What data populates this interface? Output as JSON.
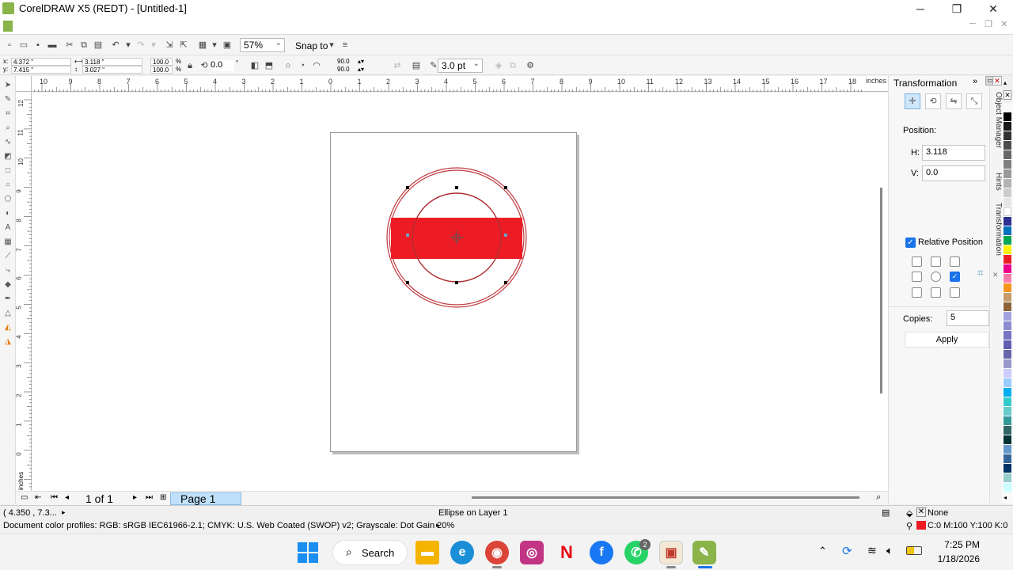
{
  "window": {
    "title": "CorelDRAW X5 (REDT) - [Untitled-1]",
    "minimize": "─",
    "maximize": "❐",
    "close": "✕"
  },
  "toolbar": {
    "zoom": "57%",
    "snap_to": "Snap to"
  },
  "propbar": {
    "x": "4.372 \"",
    "y": "7.415 \"",
    "w": "3.118 \"",
    "h": "3.027 \"",
    "scale_w": "100.0",
    "scale_h": "100.0",
    "pct": "%",
    "rotation": "0.0",
    "deg": "°",
    "start_angle": "90.0",
    "end_angle": "90.0",
    "outline_width": "3.0 pt"
  },
  "ruler": {
    "units": "inches",
    "h_labels": [
      "10",
      "9",
      "8",
      "7",
      "6",
      "5",
      "4",
      "3",
      "2",
      "1",
      "0",
      "1",
      "2",
      "3",
      "4",
      "5",
      "6",
      "7",
      "8",
      "9",
      "10",
      "11",
      "12",
      "13",
      "14",
      "15",
      "16",
      "17",
      "18"
    ],
    "v_labels": [
      "12",
      "11",
      "10",
      "9",
      "8",
      "7",
      "6",
      "5",
      "4",
      "3",
      "2",
      "1",
      "0"
    ],
    "v_units": "inches"
  },
  "navigation": {
    "page_count": "1 of 1",
    "page_tab": "Page 1"
  },
  "docker": {
    "title": "Transformation",
    "position_label": "Position:",
    "h_label": "H:",
    "h_value": "3.118",
    "v_label": "V:",
    "v_value": "0.0",
    "relative_label": "Relative Position",
    "copies_label": "Copies:",
    "copies_value": "5",
    "apply": "Apply",
    "side_tabs": [
      "Object Manager",
      "Hints",
      "Transformation"
    ]
  },
  "colors": {
    "accent_red": "#ed1c24",
    "outline_red": "#c0393f",
    "palette": [
      "#000000",
      "#1a1a1a",
      "#333333",
      "#4d4d4d",
      "#666666",
      "#808080",
      "#999999",
      "#b3b3b3",
      "#cccccc",
      "#e6e6e6",
      "#ffffff",
      "#2e3192",
      "#0072bc",
      "#00a651",
      "#fff200",
      "#ed1c24",
      "#ec008c",
      "#ff7bac",
      "#f7941d",
      "#c69c6d",
      "#8c6239",
      "#a3a3e0",
      "#8c8cd1",
      "#7575c2",
      "#5e5eb3",
      "#6666aa",
      "#9999cc",
      "#ccccff",
      "#99ccff",
      "#00aeef",
      "#33cccc",
      "#66cccc",
      "#339999",
      "#336666",
      "#003333",
      "#6699cc",
      "#336699",
      "#003366",
      "#99cccc",
      "#ccffff"
    ]
  },
  "status": {
    "coords": "( 4.350 , 7.3...",
    "object_info": "Ellipse on Layer 1",
    "color_profiles": "Document color profiles: RGB: sRGB IEC61966-2.1; CMYK: U.S. Web Coated (SWOP) v2; Grayscale: Dot Gain 20%",
    "outline_fill": "None",
    "fill_cmyk": "C:0 M:100 Y:100 K:0"
  },
  "taskbar": {
    "search": "Search",
    "time": "7:25 PM",
    "date": "1/18/2026",
    "whatsapp_badge": "2"
  }
}
